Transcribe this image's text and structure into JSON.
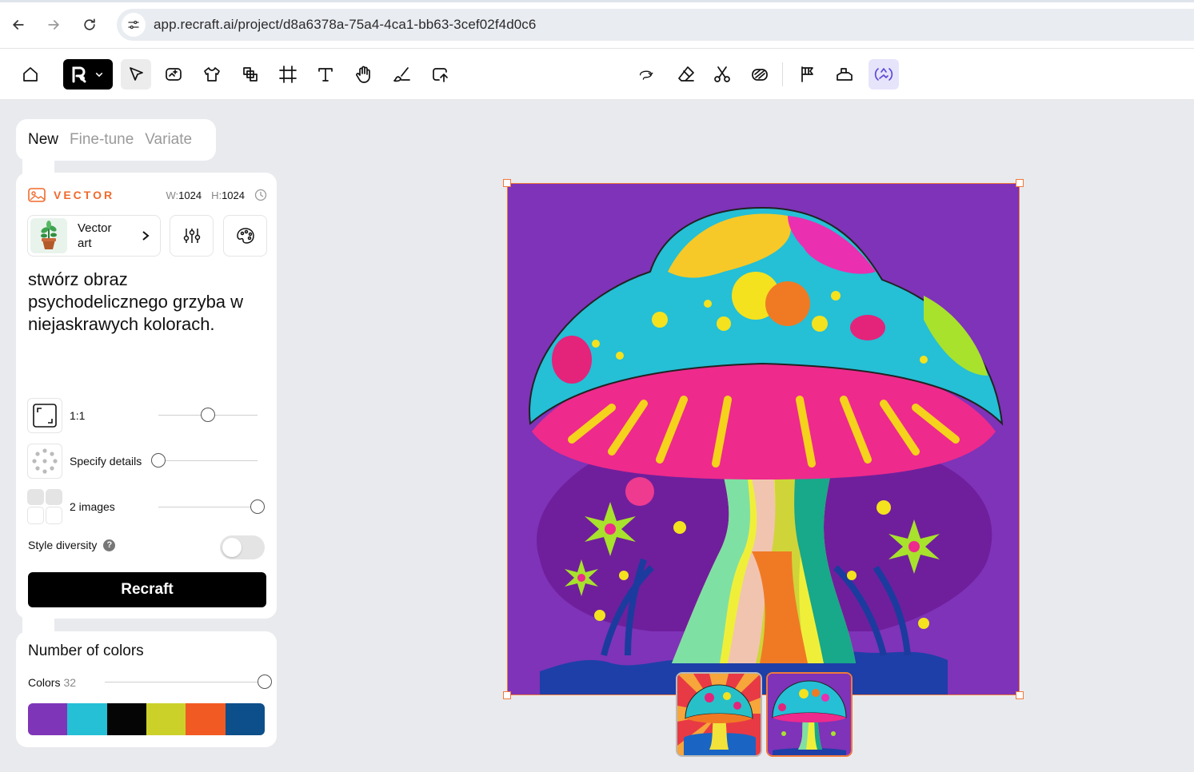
{
  "browser": {
    "url": "app.recraft.ai/project/d8a6378a-75a4-4ca1-bb63-3cef02f4d0c6",
    "back_icon": "arrow-left-icon",
    "forward_icon": "arrow-right-icon",
    "reload_icon": "reload-icon"
  },
  "toolbar": {
    "left_tools": [
      "home-icon",
      "logo-icon",
      "select-icon",
      "image-icon",
      "mockup-icon",
      "layers-icon",
      "frame-icon",
      "text-icon",
      "hand-icon",
      "brush-icon",
      "export-icon"
    ],
    "right_tools": [
      "lasso-icon",
      "eraser-icon",
      "scissors-icon",
      "remove-bg-icon",
      "upscale-icon",
      "vectorize-icon",
      "ai-edit-icon"
    ]
  },
  "mode_tabs": [
    {
      "label": "New",
      "active": true
    },
    {
      "label": "Fine-tune",
      "active": false
    },
    {
      "label": "Variate",
      "active": false
    }
  ],
  "panel": {
    "type_label": "VECTOR",
    "width_label": "W:",
    "width_value": "1024",
    "height_label": "H:",
    "height_value": "1024",
    "style_name": "Vector art",
    "prompt": "stwórz obraz psychodelicznego grzyba w niejaskrawych kolorach.",
    "aspect_label": "1:1",
    "aspect_slider": 0.5,
    "details_label": "Specify details",
    "details_slider": 0.0,
    "images_label": "2 images",
    "images_slider": 1.0,
    "style_diversity_label": "Style diversity",
    "style_diversity_help": "?",
    "style_diversity_on": false,
    "recraft_button": "Recraft"
  },
  "colors": {
    "title": "Number of colors",
    "label": "Colors",
    "count": "32",
    "slider": 1.0,
    "palette": [
      "#7f35b8",
      "#25bfd6",
      "#050505",
      "#ccd12a",
      "#f25a24",
      "#0d4f8a"
    ]
  },
  "canvas": {
    "accent": "#f07a3a",
    "background": "#7e33b8",
    "thumbnails": [
      {
        "selected": false
      },
      {
        "selected": true
      }
    ]
  }
}
